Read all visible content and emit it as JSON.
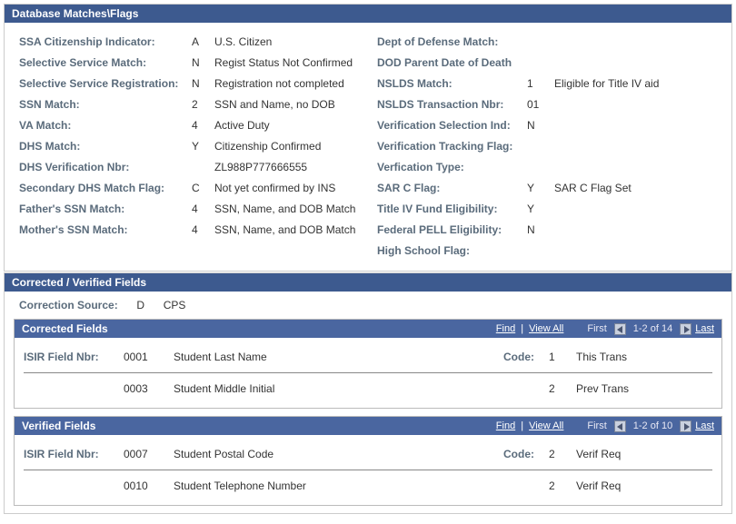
{
  "panels": {
    "dbmatches": {
      "title": "Database Matches\\Flags",
      "left": [
        {
          "label": "SSA Citizenship Indicator:",
          "code": "A",
          "desc": "U.S. Citizen"
        },
        {
          "label": "Selective Service Match:",
          "code": "N",
          "desc": "Regist Status Not Confirmed"
        },
        {
          "label": "Selective Service Registration:",
          "code": "N",
          "desc": "Registration not completed"
        },
        {
          "label": "SSN Match:",
          "code": "2",
          "desc": "SSN and Name, no DOB"
        },
        {
          "label": "VA Match:",
          "code": "4",
          "desc": "Active Duty"
        },
        {
          "label": "DHS Match:",
          "code": "Y",
          "desc": "Citizenship Confirmed"
        },
        {
          "label": "DHS Verification Nbr:",
          "code": "",
          "desc": "ZL988P777666555"
        },
        {
          "label": "Secondary DHS Match Flag:",
          "code": "C",
          "desc": "Not yet confirmed by INS"
        },
        {
          "label": "Father's SSN Match:",
          "code": "4",
          "desc": "SSN, Name, and DOB Match"
        },
        {
          "label": "Mother's SSN Match:",
          "code": "4",
          "desc": "SSN, Name, and DOB Match"
        }
      ],
      "right": [
        {
          "label": "Dept of Defense Match:",
          "code": "",
          "desc": ""
        },
        {
          "label": "DOD Parent Date of Death",
          "code": "",
          "desc": ""
        },
        {
          "label": "NSLDS Match:",
          "code": "1",
          "desc": "Eligible for Title IV aid"
        },
        {
          "label": "NSLDS Transaction Nbr:",
          "code": "01",
          "desc": ""
        },
        {
          "label": "Verification Selection Ind:",
          "code": "N",
          "desc": ""
        },
        {
          "label": "Verification Tracking Flag:",
          "code": "",
          "desc": ""
        },
        {
          "label": "Verfication Type:",
          "code": "",
          "desc": ""
        },
        {
          "label": "SAR C Flag:",
          "code": "Y",
          "desc": "SAR C Flag Set"
        },
        {
          "label": "Title IV Fund Eligibility:",
          "code": "Y",
          "desc": ""
        },
        {
          "label": "Federal PELL Eligibility:",
          "code": "N",
          "desc": ""
        },
        {
          "label": "High School Flag:",
          "code": "",
          "desc": ""
        }
      ]
    },
    "corrected": {
      "title": "Corrected / Verified Fields",
      "source_label": "Correction Source:",
      "source_code": "D",
      "source_desc": "CPS",
      "fields_title": "Corrected Fields",
      "nav": {
        "find": "Find",
        "viewall": "View All",
        "first": "First",
        "range": "1-2 of 14",
        "last": "Last"
      },
      "header_labels": {
        "field": "ISIR Field Nbr:",
        "code": "Code:"
      },
      "rows": [
        {
          "nbr": "0001",
          "name": "Student Last Name",
          "code": "1",
          "desc": "This Trans"
        },
        {
          "nbr": "0003",
          "name": "Student Middle Initial",
          "code": "2",
          "desc": "Prev Trans"
        }
      ]
    },
    "verified": {
      "title": "Verified Fields",
      "nav": {
        "find": "Find",
        "viewall": "View All",
        "first": "First",
        "range": "1-2 of 10",
        "last": "Last"
      },
      "header_labels": {
        "field": "ISIR Field Nbr:",
        "code": "Code:"
      },
      "rows": [
        {
          "nbr": "0007",
          "name": "Student Postal Code",
          "code": "2",
          "desc": "Verif Req"
        },
        {
          "nbr": "0010",
          "name": "Student Telephone Number",
          "code": "2",
          "desc": "Verif Req"
        }
      ]
    }
  }
}
